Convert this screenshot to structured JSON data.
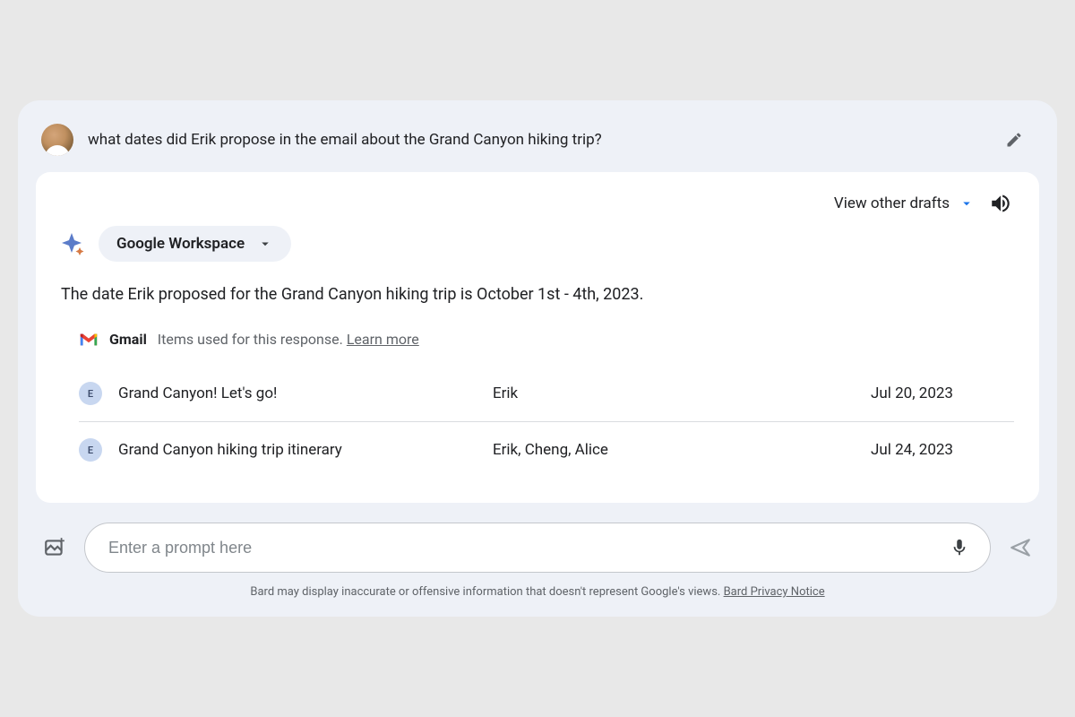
{
  "prompt": {
    "text": "what dates did Erik propose in the email about the Grand Canyon hiking trip?"
  },
  "response": {
    "view_other_drafts": "View other drafts",
    "workspace_chip": "Google Workspace",
    "answer": "The date Erik proposed for the Grand Canyon hiking trip is October 1st - 4th, 2023.",
    "source": {
      "app": "Gmail",
      "text": "Items used for this response.",
      "learn_more": "Learn more"
    },
    "emails": [
      {
        "badge": "E",
        "subject": "Grand Canyon! Let's go!",
        "from": "Erik",
        "date": "Jul 20, 2023"
      },
      {
        "badge": "E",
        "subject": "Grand Canyon hiking trip itinerary",
        "from": "Erik, Cheng, Alice",
        "date": "Jul 24, 2023"
      }
    ]
  },
  "input": {
    "placeholder": "Enter a prompt here"
  },
  "disclaimer": {
    "text": "Bard may display inaccurate or offensive information that doesn't represent Google's views.",
    "link": "Bard Privacy Notice"
  }
}
